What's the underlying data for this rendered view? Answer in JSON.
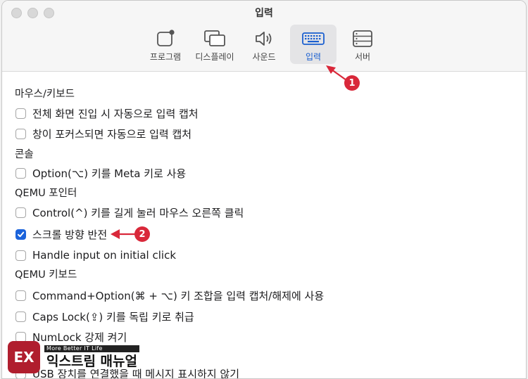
{
  "window": {
    "title": "입력"
  },
  "toolbar": {
    "tabs": [
      {
        "label": "프로그램",
        "icon": "program-icon"
      },
      {
        "label": "디스플레이",
        "icon": "display-icon"
      },
      {
        "label": "사운드",
        "icon": "speaker-icon"
      },
      {
        "label": "입력",
        "icon": "keyboard-icon",
        "selected": true
      },
      {
        "label": "서버",
        "icon": "server-icon"
      }
    ]
  },
  "sections": [
    {
      "title": "마우스/키보드",
      "options": [
        {
          "label": "전체 화면 진입 시 자동으로 입력 캡처",
          "checked": false
        },
        {
          "label": "창이 포커스되면 자동으로 입력 캡처",
          "checked": false
        }
      ]
    },
    {
      "title": "콘솔",
      "options": [
        {
          "label": "Option(⌥) 키를 Meta 키로 사용",
          "checked": false
        }
      ]
    },
    {
      "title": "QEMU 포인터",
      "options": [
        {
          "label": "Control(^) 키를 길게 눌러 마우스 오른쪽 클릭",
          "checked": false
        },
        {
          "label": "스크롤 방향 반전",
          "checked": true
        },
        {
          "label": "Handle input on initial click",
          "checked": false
        }
      ]
    },
    {
      "title": "QEMU 키보드",
      "options": [
        {
          "label": "Command+Option(⌘ + ⌥) 키 조합을 입력 캡처/해제에 사용",
          "checked": false
        },
        {
          "label": "Caps Lock(⇪) 키를 독립 키로 취급",
          "checked": false
        },
        {
          "label": "NumLock 강제 켜기",
          "checked": false
        },
        {
          "label": "USB 장치를 연결했을 때 메시지 표시하지 않기",
          "checked": false
        }
      ]
    }
  ],
  "annotations": [
    {
      "number": "1"
    },
    {
      "number": "2"
    }
  ],
  "watermark": {
    "badge": "EX",
    "tagline": "More Better IT Life",
    "name": "익스트림 매뉴얼"
  },
  "colors": {
    "accent": "#1b63db",
    "marker": "#d9283a",
    "brand": "#b01e2e"
  }
}
